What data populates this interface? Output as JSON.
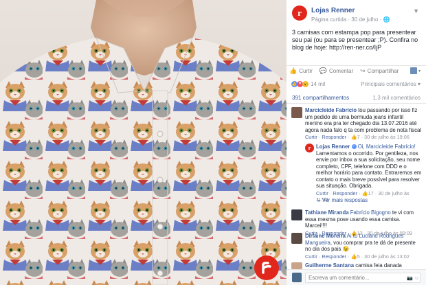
{
  "post": {
    "page_name": "Lojas Renner",
    "page_initial": "r",
    "meta": "Página curtida · 30 de julho · ",
    "meta_icon": "globe-icon",
    "text": "3 camisas com estampa pop para presentear seu pai (ou para se presentear ;P). Confira no blog de hoje: http://ren-ner.co/IjP"
  },
  "actions": {
    "like": "Curtir",
    "comment": "Comentar",
    "share": "Compartilhar"
  },
  "reactions": {
    "count": "14 mil",
    "ranking": "Principais comentários ▾"
  },
  "counts": {
    "shares": "391 compartilhamentos",
    "comments": "1,3 mil comentários"
  },
  "comments": [
    {
      "name": "Marcicleide Fabrício",
      "text": " tou passando por isso fiz um pedido de uma bermuda jeans infantil menino era pra ter chegado dia 13.07.2016 até agora nada falo q ta com problema de nota fiscal",
      "links": "Curtir · Responder · ",
      "likes": "7",
      "date": " · 30 de julho às 19:06"
    },
    {
      "name": "Tathiane Miranda",
      "tag": " Fabrício Bigogno",
      "text": " te vi com essa mesma pose usando essa camisa. Marcei!!!!",
      "links": "Curtir · Responder · ",
      "likes": "13",
      "date": " · 30 de julho às 09:09"
    },
    {
      "name": "Dirlaine Moreira",
      "tag": " Ai tu Luciano Rodrigues Mangueira",
      "text": ", vou comprar pra te dá de presente no dia dos pais 😉",
      "links": "Curtir · Responder · ",
      "likes": "5",
      "date": " · 30 de julho às 13:02"
    },
    {
      "name": "Guilherme Santana",
      "text": " camisa feia danada"
    }
  ],
  "reply": {
    "name": "Lojas Renner",
    "tag": " Oi, Marcicleide Fabrício!",
    "text": " Lamentamos o ocorrido. Por gentileza, nos envie por inbox a sua solicitação, seu nome completo, CPF, telefone com DDD e o melhor horário para contato. Entraremos em contato o mais breve possível para resolver sua situação. Obrigada.",
    "links": "Curtir · Responder · ",
    "likes": "17",
    "date": " · 30 de julho às 11:32",
    "more": "↳ Ver mais respostas"
  },
  "compose": {
    "placeholder": "Escreva um comentário..."
  },
  "colors": {
    "brand_red": "#e1261c",
    "link_blue": "#365899"
  }
}
